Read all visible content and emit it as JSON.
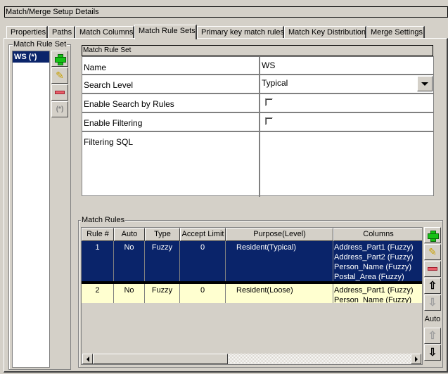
{
  "window": {
    "title": "Match/Merge Setup Details"
  },
  "tabs": [
    {
      "label": "Properties",
      "active": false
    },
    {
      "label": "Paths",
      "active": false
    },
    {
      "label": "Match Columns",
      "active": false
    },
    {
      "label": "Match Rule Sets",
      "active": true
    },
    {
      "label": "Primary key match rules",
      "active": false
    },
    {
      "label": "Match Key Distribution",
      "active": false
    },
    {
      "label": "Merge Settings",
      "active": false
    }
  ],
  "rule_set_panel": {
    "label": "Match Rule Set",
    "items": [
      {
        "label": "WS (*)",
        "selected": true
      }
    ],
    "buttons": {
      "add": "add-icon",
      "edit": "pencil-icon",
      "remove": "remove-icon",
      "default_label": "(*)"
    }
  },
  "rule_set_details": {
    "header": "Match Rule Set",
    "name_label": "Name",
    "name_value": "WS",
    "search_level_label": "Search Level",
    "search_level_value": "Typical",
    "enable_search_by_rules_label": "Enable Search by Rules",
    "enable_search_by_rules_checked": false,
    "enable_filtering_label": "Enable Filtering",
    "enable_filtering_checked": false,
    "filtering_sql_label": "Filtering SQL",
    "filtering_sql_value": ""
  },
  "match_rules": {
    "label": "Match Rules",
    "columns": [
      "Rule #",
      "Auto",
      "Type",
      "Accept Limit",
      "Purpose(Level)",
      "Columns"
    ],
    "rows": [
      {
        "rule": "1",
        "auto": "No",
        "type": "Fuzzy",
        "accept_limit": "0",
        "purpose": "Resident(Typical)",
        "columns": [
          "Address_Part1 (Fuzzy)",
          "Address_Part2 (Fuzzy)",
          "Person_Name (Fuzzy)",
          "Postal_Area (Fuzzy)"
        ],
        "selected": true
      },
      {
        "rule": "2",
        "auto": "No",
        "type": "Fuzzy",
        "accept_limit": "0",
        "purpose": "Resident(Loose)",
        "columns": [
          "Address_Part1 (Fuzzy)",
          "Person_Name (Fuzzy)"
        ],
        "selected": false
      }
    ],
    "auto_label": "Auto"
  }
}
